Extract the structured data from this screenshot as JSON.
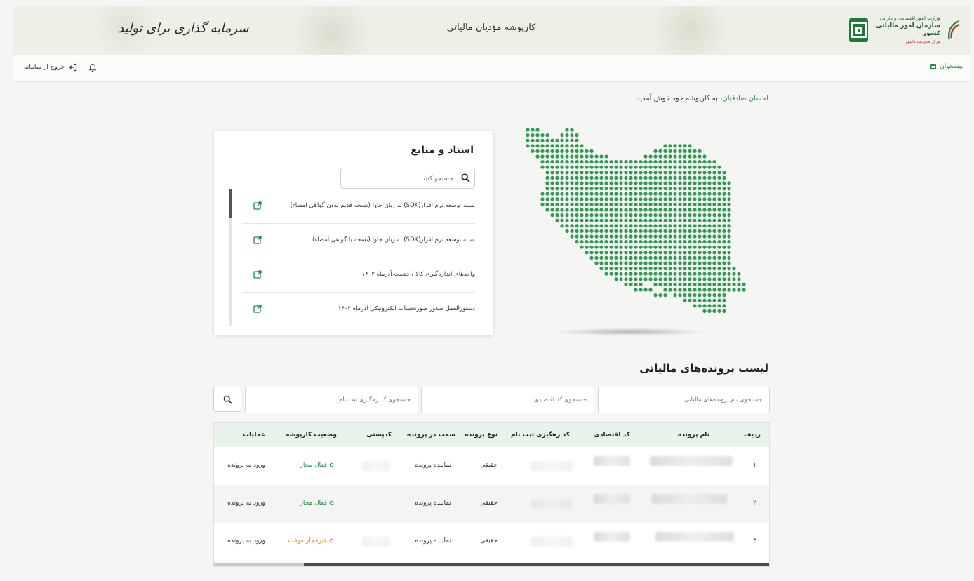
{
  "header": {
    "title": "کارپوشه مؤدیان مالیاتی",
    "logo_line1": "وزارت امور اقتصادی و دارایی",
    "logo_line2": "سازمان امور مالیاتی کشور",
    "logo_line3": "مرکز مدیریت دانش",
    "calligraphy": "سرمایه گذاری برای تولید"
  },
  "topbar": {
    "dashboard_label": "پیشخوان",
    "logout_label": "خروج از سامانه"
  },
  "welcome": {
    "name": "احسان صادقیان",
    "message": "، به کارپوشه خود خوش آمدید."
  },
  "docs": {
    "title": "اسناد و منابع",
    "search_placeholder": "جستجو کنید",
    "items": [
      {
        "label": "بسته توسعه نرم افزار(SDK) به زبان جاوا (نسخه قدیم بدون گواهی امضاء)"
      },
      {
        "label": "بسته توسعه نرم افزار(SDK) به زبان جاوا (نسخه با گواهی امضاء)"
      },
      {
        "label": "واحدهای اندازه‌گیری کالا / خدمت آذرماه ۱۴۰۲"
      },
      {
        "label": "دستورالعمل صدور صورتحساب الکترونیکی آذرماه ۱۴۰۲"
      }
    ]
  },
  "files": {
    "title": "لیست پرونده‌های مالیاتی",
    "filter_name_placeholder": "جستجوی نام پرونده‌های مالیاتی",
    "filter_economic_placeholder": "جستجوی کد اقتصادی",
    "filter_tracking_placeholder": "جستجوی کد رهگیری ثبت نام",
    "columns": [
      "ردیف",
      "نام پرونده",
      "کد اقتصادی",
      "کد رهگیری ثبت نام",
      "نوع پرونده",
      "سمت در پرونده",
      "کدپستی",
      "وضعیت کارپوشه",
      "عملیات"
    ],
    "rows": [
      {
        "index": "۱",
        "type": "حقیقی",
        "role": "نماینده پرونده",
        "status": "فعال مجاز",
        "op": "ورود به پرونده"
      },
      {
        "index": "۲",
        "type": "حقیقی",
        "role": "نماینده پرونده",
        "status": "فعال مجاز",
        "op": "ورود به پرونده"
      },
      {
        "index": "۳",
        "type": "حقیقی",
        "role": "نماینده پرونده",
        "status": "غیرمجاز موقت",
        "op": "ورود به پرونده"
      }
    ]
  },
  "colors": {
    "accent": "#1f8a4a",
    "map_dot": "#2e9a52",
    "warn": "#e0862a"
  }
}
